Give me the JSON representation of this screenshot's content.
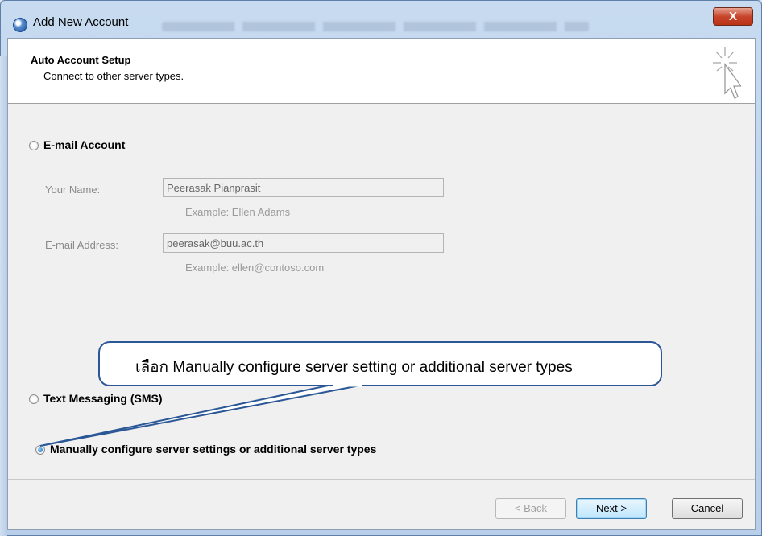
{
  "window": {
    "title": "Add New Account",
    "close_label": "X"
  },
  "header": {
    "title": "Auto Account Setup",
    "subtitle": "Connect to other server types."
  },
  "options": {
    "email_account": "E-mail Account",
    "text_messaging": "Text Messaging (SMS)",
    "manual": "Manually configure server settings or additional server types",
    "selected": "manual"
  },
  "form": {
    "name_label": "Your Name:",
    "name_value": "Peerasak Pianprasit",
    "name_example": "Example: Ellen Adams",
    "email_label": "E-mail Address:",
    "email_value": "peerasak@buu.ac.th",
    "email_example": "Example: ellen@contoso.com"
  },
  "callout": {
    "text": "เลือก Manually configure server setting or additional server types"
  },
  "buttons": {
    "back": "< Back",
    "next": "Next >",
    "cancel": "Cancel"
  },
  "colors": {
    "callout_border": "#2b5797",
    "close_button": "#c8452d",
    "dialog_bg": "#f0f0f0"
  }
}
